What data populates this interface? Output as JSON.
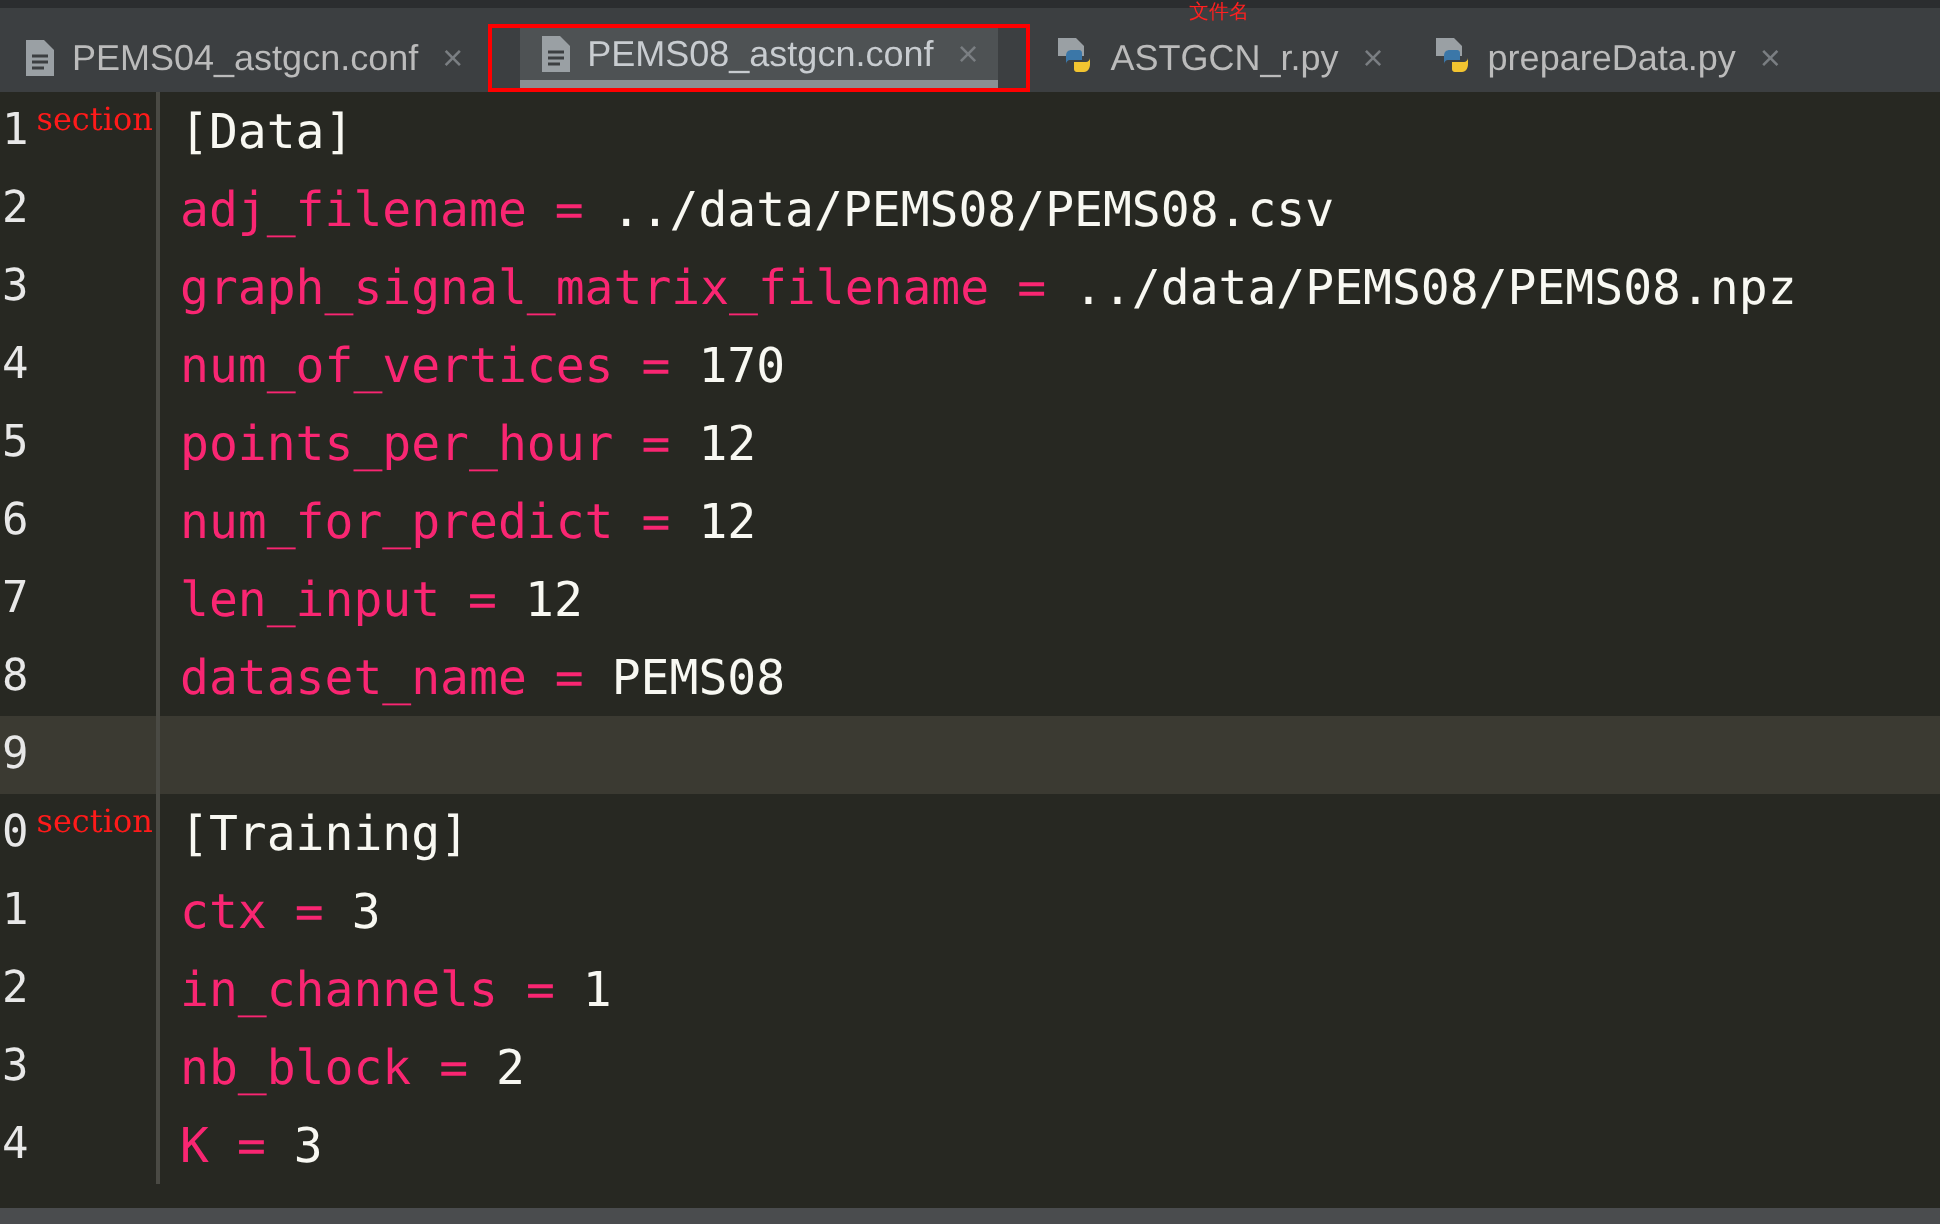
{
  "tabs": [
    {
      "label": "PEMS04_astgcn.conf",
      "kind": "file",
      "selected": false,
      "close": "×",
      "highlighted": false
    },
    {
      "label": "PEMS08_astgcn.conf",
      "kind": "file",
      "selected": true,
      "close": "×",
      "highlighted": true
    },
    {
      "label": "ASTGCN_r.py",
      "kind": "python",
      "selected": false,
      "close": "×",
      "highlighted": false,
      "note": "文件名"
    },
    {
      "label": "prepareData.py",
      "kind": "python",
      "selected": false,
      "close": "×",
      "highlighted": false
    }
  ],
  "lines": [
    {
      "number": "1",
      "kind": "section",
      "text": "[Data]",
      "note": "section",
      "current": false
    },
    {
      "number": "2",
      "kind": "assign",
      "key": "adj_filename",
      "op": "=",
      "value": "../data/PEMS08/PEMS08.csv",
      "current": false
    },
    {
      "number": "3",
      "kind": "assign",
      "key": "graph_signal_matrix_filename",
      "op": "=",
      "value": "../data/PEMS08/PEMS08.npz",
      "current": false
    },
    {
      "number": "4",
      "kind": "assign",
      "key": "num_of_vertices",
      "op": "=",
      "value": "170",
      "current": false
    },
    {
      "number": "5",
      "kind": "assign",
      "key": "points_per_hour",
      "op": "=",
      "value": "12",
      "current": false
    },
    {
      "number": "6",
      "kind": "assign",
      "key": "num_for_predict",
      "op": "=",
      "value": "12",
      "current": false
    },
    {
      "number": "7",
      "kind": "assign",
      "key": "len_input",
      "op": "=",
      "value": "12",
      "current": false
    },
    {
      "number": "8",
      "kind": "assign",
      "key": "dataset_name",
      "op": "=",
      "value": "PEMS08",
      "current": false
    },
    {
      "number": "9",
      "kind": "blank",
      "current": true
    },
    {
      "number": "0",
      "kind": "section",
      "text": "[Training]",
      "note": "section",
      "current": false
    },
    {
      "number": "1",
      "kind": "assign",
      "key": "ctx",
      "op": "=",
      "value": "3",
      "current": false
    },
    {
      "number": "2",
      "kind": "assign",
      "key": "in_channels",
      "op": "=",
      "value": "1",
      "current": false
    },
    {
      "number": "3",
      "kind": "assign",
      "key": "nb_block",
      "op": "=",
      "value": "2",
      "current": false
    },
    {
      "number": "4",
      "kind": "assign",
      "key": "K",
      "op": "=",
      "value": "3",
      "current": false
    }
  ]
}
